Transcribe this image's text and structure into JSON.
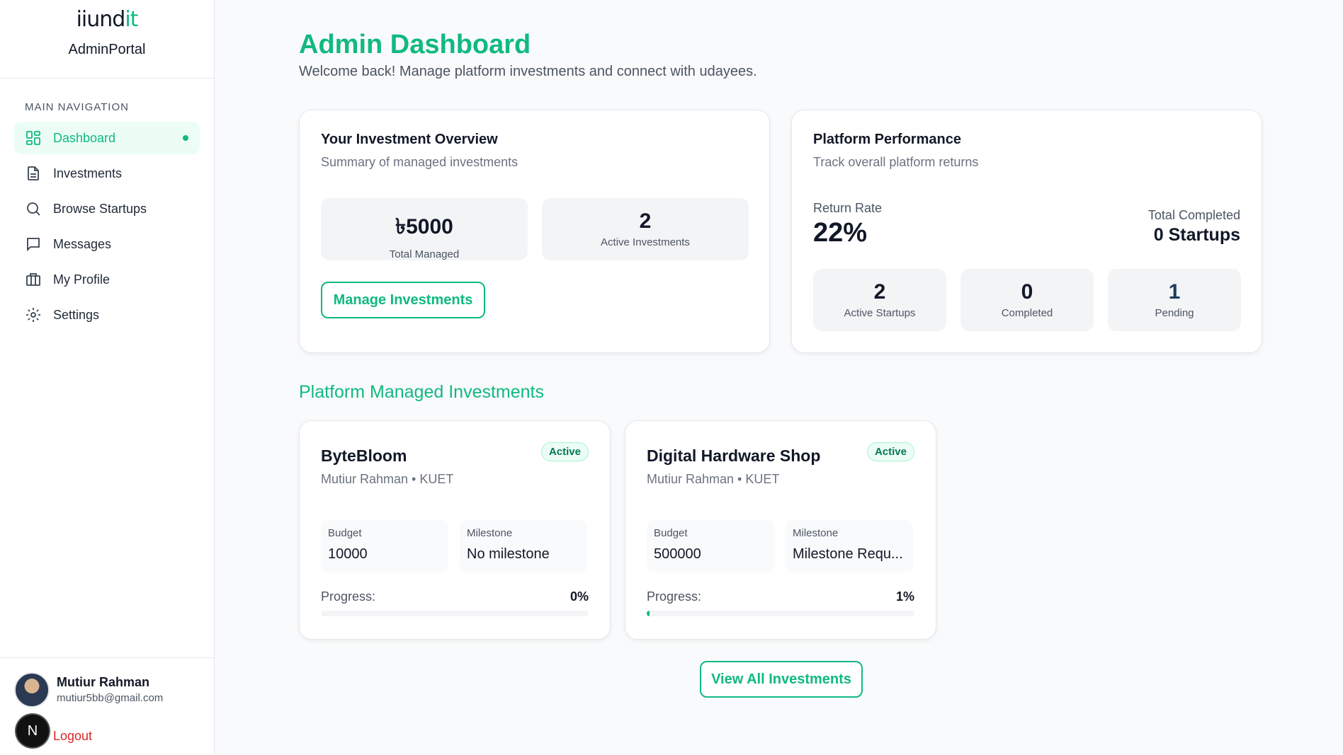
{
  "brand": {
    "logo_main": "iiund",
    "logo_accent": "it",
    "portal": "AdminPortal"
  },
  "sidebar": {
    "section_title": "MAIN NAVIGATION",
    "items": [
      {
        "label": "Dashboard",
        "icon": "dashboard-icon",
        "active": true
      },
      {
        "label": "Investments",
        "icon": "document-icon"
      },
      {
        "label": "Browse Startups",
        "icon": "search-icon"
      },
      {
        "label": "Messages",
        "icon": "message-icon"
      },
      {
        "label": "My Profile",
        "icon": "briefcase-icon"
      },
      {
        "label": "Settings",
        "icon": "gear-icon"
      }
    ]
  },
  "user": {
    "name": "Mutiur Rahman",
    "email": "mutiur5bb@gmail.com",
    "badge": "N",
    "logout": "Logout"
  },
  "header": {
    "title": "Admin Dashboard",
    "subtitle": "Welcome back! Manage platform investments and connect with udayees."
  },
  "overview": {
    "title": "Your Investment Overview",
    "subtitle": "Summary of managed investments",
    "total_managed_value": "৳5000",
    "total_managed_label": "Total Managed",
    "active_value": "2",
    "active_label": "Active Investments",
    "manage_button": "Manage Investments"
  },
  "performance": {
    "title": "Platform Performance",
    "subtitle": "Track overall platform returns",
    "return_rate_label": "Return Rate",
    "return_rate_value": "22%",
    "total_completed_label": "Total Completed",
    "total_completed_value": "0 Startups",
    "stats": [
      {
        "value": "2",
        "label": "Active Startups"
      },
      {
        "value": "0",
        "label": "Completed"
      },
      {
        "value": "1",
        "label": "Pending"
      }
    ]
  },
  "investments": {
    "section_title": "Platform Managed Investments",
    "items": [
      {
        "title": "ByteBloom",
        "subtitle": "Mutiur Rahman • KUET",
        "status": "Active",
        "budget_label": "Budget",
        "budget": "10000",
        "milestone_label": "Milestone",
        "milestone": "No milestone",
        "progress_label": "Progress:",
        "progress_text": "0%",
        "progress": 0
      },
      {
        "title": "Digital Hardware Shop",
        "subtitle": "Mutiur Rahman • KUET",
        "status": "Active",
        "budget_label": "Budget",
        "budget": "500000",
        "milestone_label": "Milestone",
        "milestone": "Milestone Requ...",
        "progress_label": "Progress:",
        "progress_text": "1%",
        "progress": 1
      }
    ],
    "view_all_button": "View All Investments"
  },
  "colors": {
    "accent": "#10b981",
    "danger": "#dc2626"
  }
}
